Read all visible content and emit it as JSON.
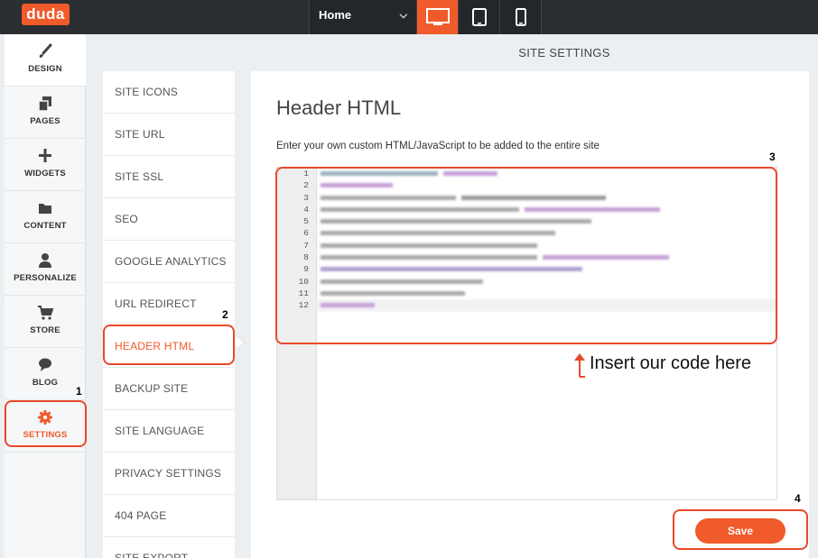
{
  "topbar": {
    "logo": "duda",
    "page_select": "Home",
    "devices": [
      {
        "name": "desktop-icon",
        "active": true
      },
      {
        "name": "tablet-icon",
        "active": false
      },
      {
        "name": "mobile-icon",
        "active": false
      }
    ]
  },
  "leftnav": {
    "items": [
      {
        "label": "DESIGN",
        "icon": "brush-icon"
      },
      {
        "label": "PAGES",
        "icon": "pages-icon"
      },
      {
        "label": "WIDGETS",
        "icon": "plus-icon"
      },
      {
        "label": "CONTENT",
        "icon": "folder-icon"
      },
      {
        "label": "PERSONALIZE",
        "icon": "person-icon"
      },
      {
        "label": "STORE",
        "icon": "cart-icon"
      },
      {
        "label": "BLOG",
        "icon": "chat-bubble-icon"
      },
      {
        "label": "SETTINGS",
        "icon": "gear-icon",
        "active": true
      }
    ]
  },
  "site_settings_title": "SITE SETTINGS",
  "settings_menu": {
    "items": [
      {
        "label": "SITE ICONS"
      },
      {
        "label": "SITE URL"
      },
      {
        "label": "SITE SSL"
      },
      {
        "label": "SEO"
      },
      {
        "label": "GOOGLE ANALYTICS"
      },
      {
        "label": "URL REDIRECT"
      },
      {
        "label": "HEADER HTML",
        "active": true
      },
      {
        "label": "BACKUP SITE"
      },
      {
        "label": "SITE LANGUAGE"
      },
      {
        "label": "PRIVACY SETTINGS"
      },
      {
        "label": "404 PAGE"
      },
      {
        "label": "SITE EXPORT"
      }
    ]
  },
  "panel": {
    "title": "Header HTML",
    "description": "Enter your own custom HTML/JavaScript to be added to the entire site",
    "line_numbers": [
      "1",
      "2",
      "3",
      "4",
      "5",
      "6",
      "7",
      "8",
      "9",
      "10",
      "11",
      "12"
    ],
    "save_label": "Save"
  },
  "annotations": {
    "step1": "1",
    "step2": "2",
    "step3": "3",
    "step4": "4",
    "insert_note": "Insert our code here",
    "color": "#e8492a"
  },
  "colors": {
    "accent": "#f15a2a",
    "topbar": "#2b2e33"
  }
}
